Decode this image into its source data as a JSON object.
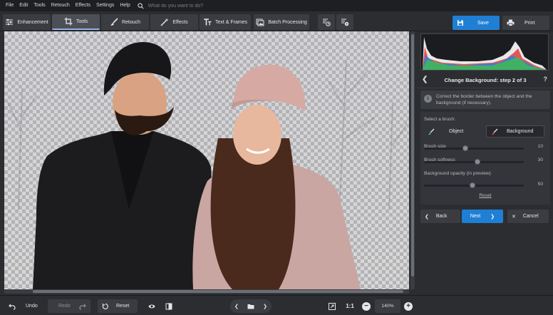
{
  "menu": {
    "items": [
      "File",
      "Edit",
      "Tools",
      "Retouch",
      "Effects",
      "Settings",
      "Help"
    ],
    "search_placeholder": "What do you want to do?"
  },
  "toolbar": {
    "tabs": [
      {
        "label": "Enhancement",
        "icon": "sliders-icon",
        "active": false
      },
      {
        "label": "Tools",
        "icon": "crop-icon",
        "active": true
      },
      {
        "label": "Retouch",
        "icon": "brush-icon",
        "active": false
      },
      {
        "label": "Effects",
        "icon": "magic-wand-icon",
        "active": false
      },
      {
        "label": "Text & Frames",
        "icon": "text-icon",
        "active": false
      },
      {
        "label": "Batch Processing",
        "icon": "images-icon",
        "active": false
      }
    ],
    "save_label": "Save",
    "print_label": "Print"
  },
  "panel": {
    "step_title": "Change Background: step 2 of 3",
    "help": "?",
    "info_text": "Correct the border between the object and the background (if necessary).",
    "select_brush_label": "Select a brush:",
    "brush_object": "Object",
    "brush_background": "Background",
    "brush_size_label": "Brush size",
    "brush_size_value": "10",
    "brush_softness_label": "Brush softness",
    "brush_softness_value": "30",
    "bg_opacity_label": "Background opacity (in preview)",
    "bg_opacity_value": "50",
    "reset_link": "Reset",
    "back_label": "Back",
    "next_label": "Next",
    "cancel_label": "Cancel"
  },
  "bottom": {
    "undo_label": "Undo",
    "redo_label": "Redo",
    "reset_label": "Reset",
    "ratio_label": "1:1",
    "zoom_value": "140%"
  },
  "colors": {
    "accent": "#1f7fd4",
    "panel_bg": "#2b2d31",
    "button_bg": "#3a3c41"
  }
}
